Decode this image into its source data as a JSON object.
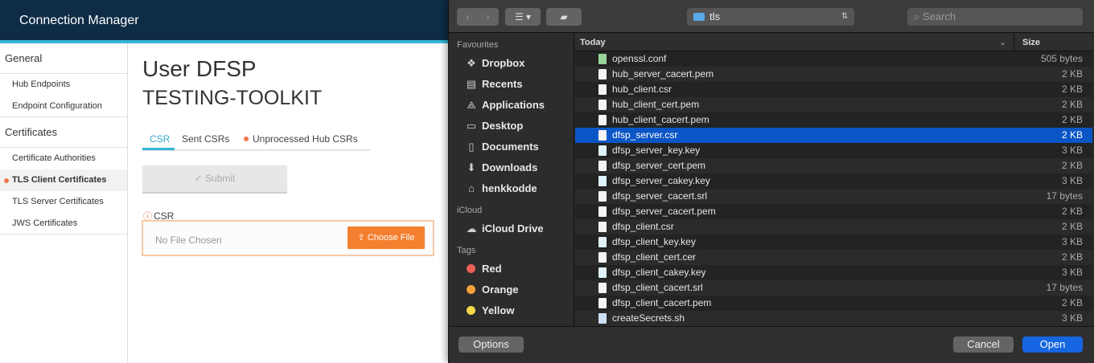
{
  "app": {
    "title": "Connection Manager"
  },
  "sidenav": {
    "sections": [
      {
        "label": "General",
        "items": [
          "Hub Endpoints",
          "Endpoint Configuration"
        ]
      },
      {
        "label": "Certificates",
        "items": [
          "Certificate Authorities",
          "TLS Client Certificates",
          "TLS Server Certificates",
          "JWS Certificates"
        ]
      }
    ],
    "active_item": "TLS Client Certificates"
  },
  "page": {
    "title": "User DFSP",
    "subtitle": "TESTING-TOOLKIT",
    "tabs": [
      "CSR",
      "Sent CSRs",
      "Unprocessed Hub CSRs"
    ],
    "active_tab": "CSR",
    "submit_label": "Submit",
    "submit_icon": "check-icon",
    "csr_label": "CSR",
    "file_placeholder": "No File Chosen",
    "choose_file_label": "Choose File",
    "choose_file_icon": "upload-icon",
    "accent_color": "#35b6d9",
    "warning_color": "#f0794c",
    "button_color": "#f47f2f"
  },
  "dialog": {
    "location": "tls",
    "search_placeholder": "Search",
    "favourites_heading": "Favourites",
    "favourites": [
      {
        "label": "Dropbox",
        "icon": "dropbox-icon"
      },
      {
        "label": "Recents",
        "icon": "recents-icon"
      },
      {
        "label": "Applications",
        "icon": "applications-icon"
      },
      {
        "label": "Desktop",
        "icon": "desktop-icon"
      },
      {
        "label": "Documents",
        "icon": "documents-icon"
      },
      {
        "label": "Downloads",
        "icon": "downloads-icon"
      },
      {
        "label": "henkkodde",
        "icon": "home-icon"
      }
    ],
    "icloud_heading": "iCloud",
    "icloud_items": [
      {
        "label": "iCloud Drive",
        "icon": "cloud-icon"
      }
    ],
    "tags_heading": "Tags",
    "tags": [
      {
        "label": "Red",
        "color": "#ec5f59"
      },
      {
        "label": "Orange",
        "color": "#f5a13a"
      },
      {
        "label": "Yellow",
        "color": "#f6d84a"
      }
    ],
    "column_name": "Today",
    "column_size": "Size",
    "files": [
      {
        "name": "openssl.conf",
        "size": "505 bytes",
        "kind": "conf"
      },
      {
        "name": "hub_server_cacert.pem",
        "size": "2 KB",
        "kind": "doc"
      },
      {
        "name": "hub_client.csr",
        "size": "2 KB",
        "kind": "doc"
      },
      {
        "name": "hub_client_cert.pem",
        "size": "2 KB",
        "kind": "doc"
      },
      {
        "name": "hub_client_cacert.pem",
        "size": "2 KB",
        "kind": "doc"
      },
      {
        "name": "dfsp_server.csr",
        "size": "2 KB",
        "kind": "doc"
      },
      {
        "name": "dfsp_server_key.key",
        "size": "3 KB",
        "kind": "key"
      },
      {
        "name": "dfsp_server_cert.pem",
        "size": "2 KB",
        "kind": "doc"
      },
      {
        "name": "dfsp_server_cakey.key",
        "size": "3 KB",
        "kind": "key"
      },
      {
        "name": "dfsp_server_cacert.srl",
        "size": "17 bytes",
        "kind": "doc"
      },
      {
        "name": "dfsp_server_cacert.pem",
        "size": "2 KB",
        "kind": "doc"
      },
      {
        "name": "dfsp_client.csr",
        "size": "2 KB",
        "kind": "doc"
      },
      {
        "name": "dfsp_client_key.key",
        "size": "3 KB",
        "kind": "key"
      },
      {
        "name": "dfsp_client_cert.cer",
        "size": "2 KB",
        "kind": "doc"
      },
      {
        "name": "dfsp_client_cakey.key",
        "size": "3 KB",
        "kind": "key"
      },
      {
        "name": "dfsp_client_cacert.srl",
        "size": "17 bytes",
        "kind": "doc"
      },
      {
        "name": "dfsp_client_cacert.pem",
        "size": "2 KB",
        "kind": "doc"
      },
      {
        "name": "createSecrets.sh",
        "size": "3 KB",
        "kind": "sh"
      }
    ],
    "selected_file": "dfsp_server.csr",
    "options_label": "Options",
    "cancel_label": "Cancel",
    "open_label": "Open",
    "selection_color": "#0b56c6"
  }
}
